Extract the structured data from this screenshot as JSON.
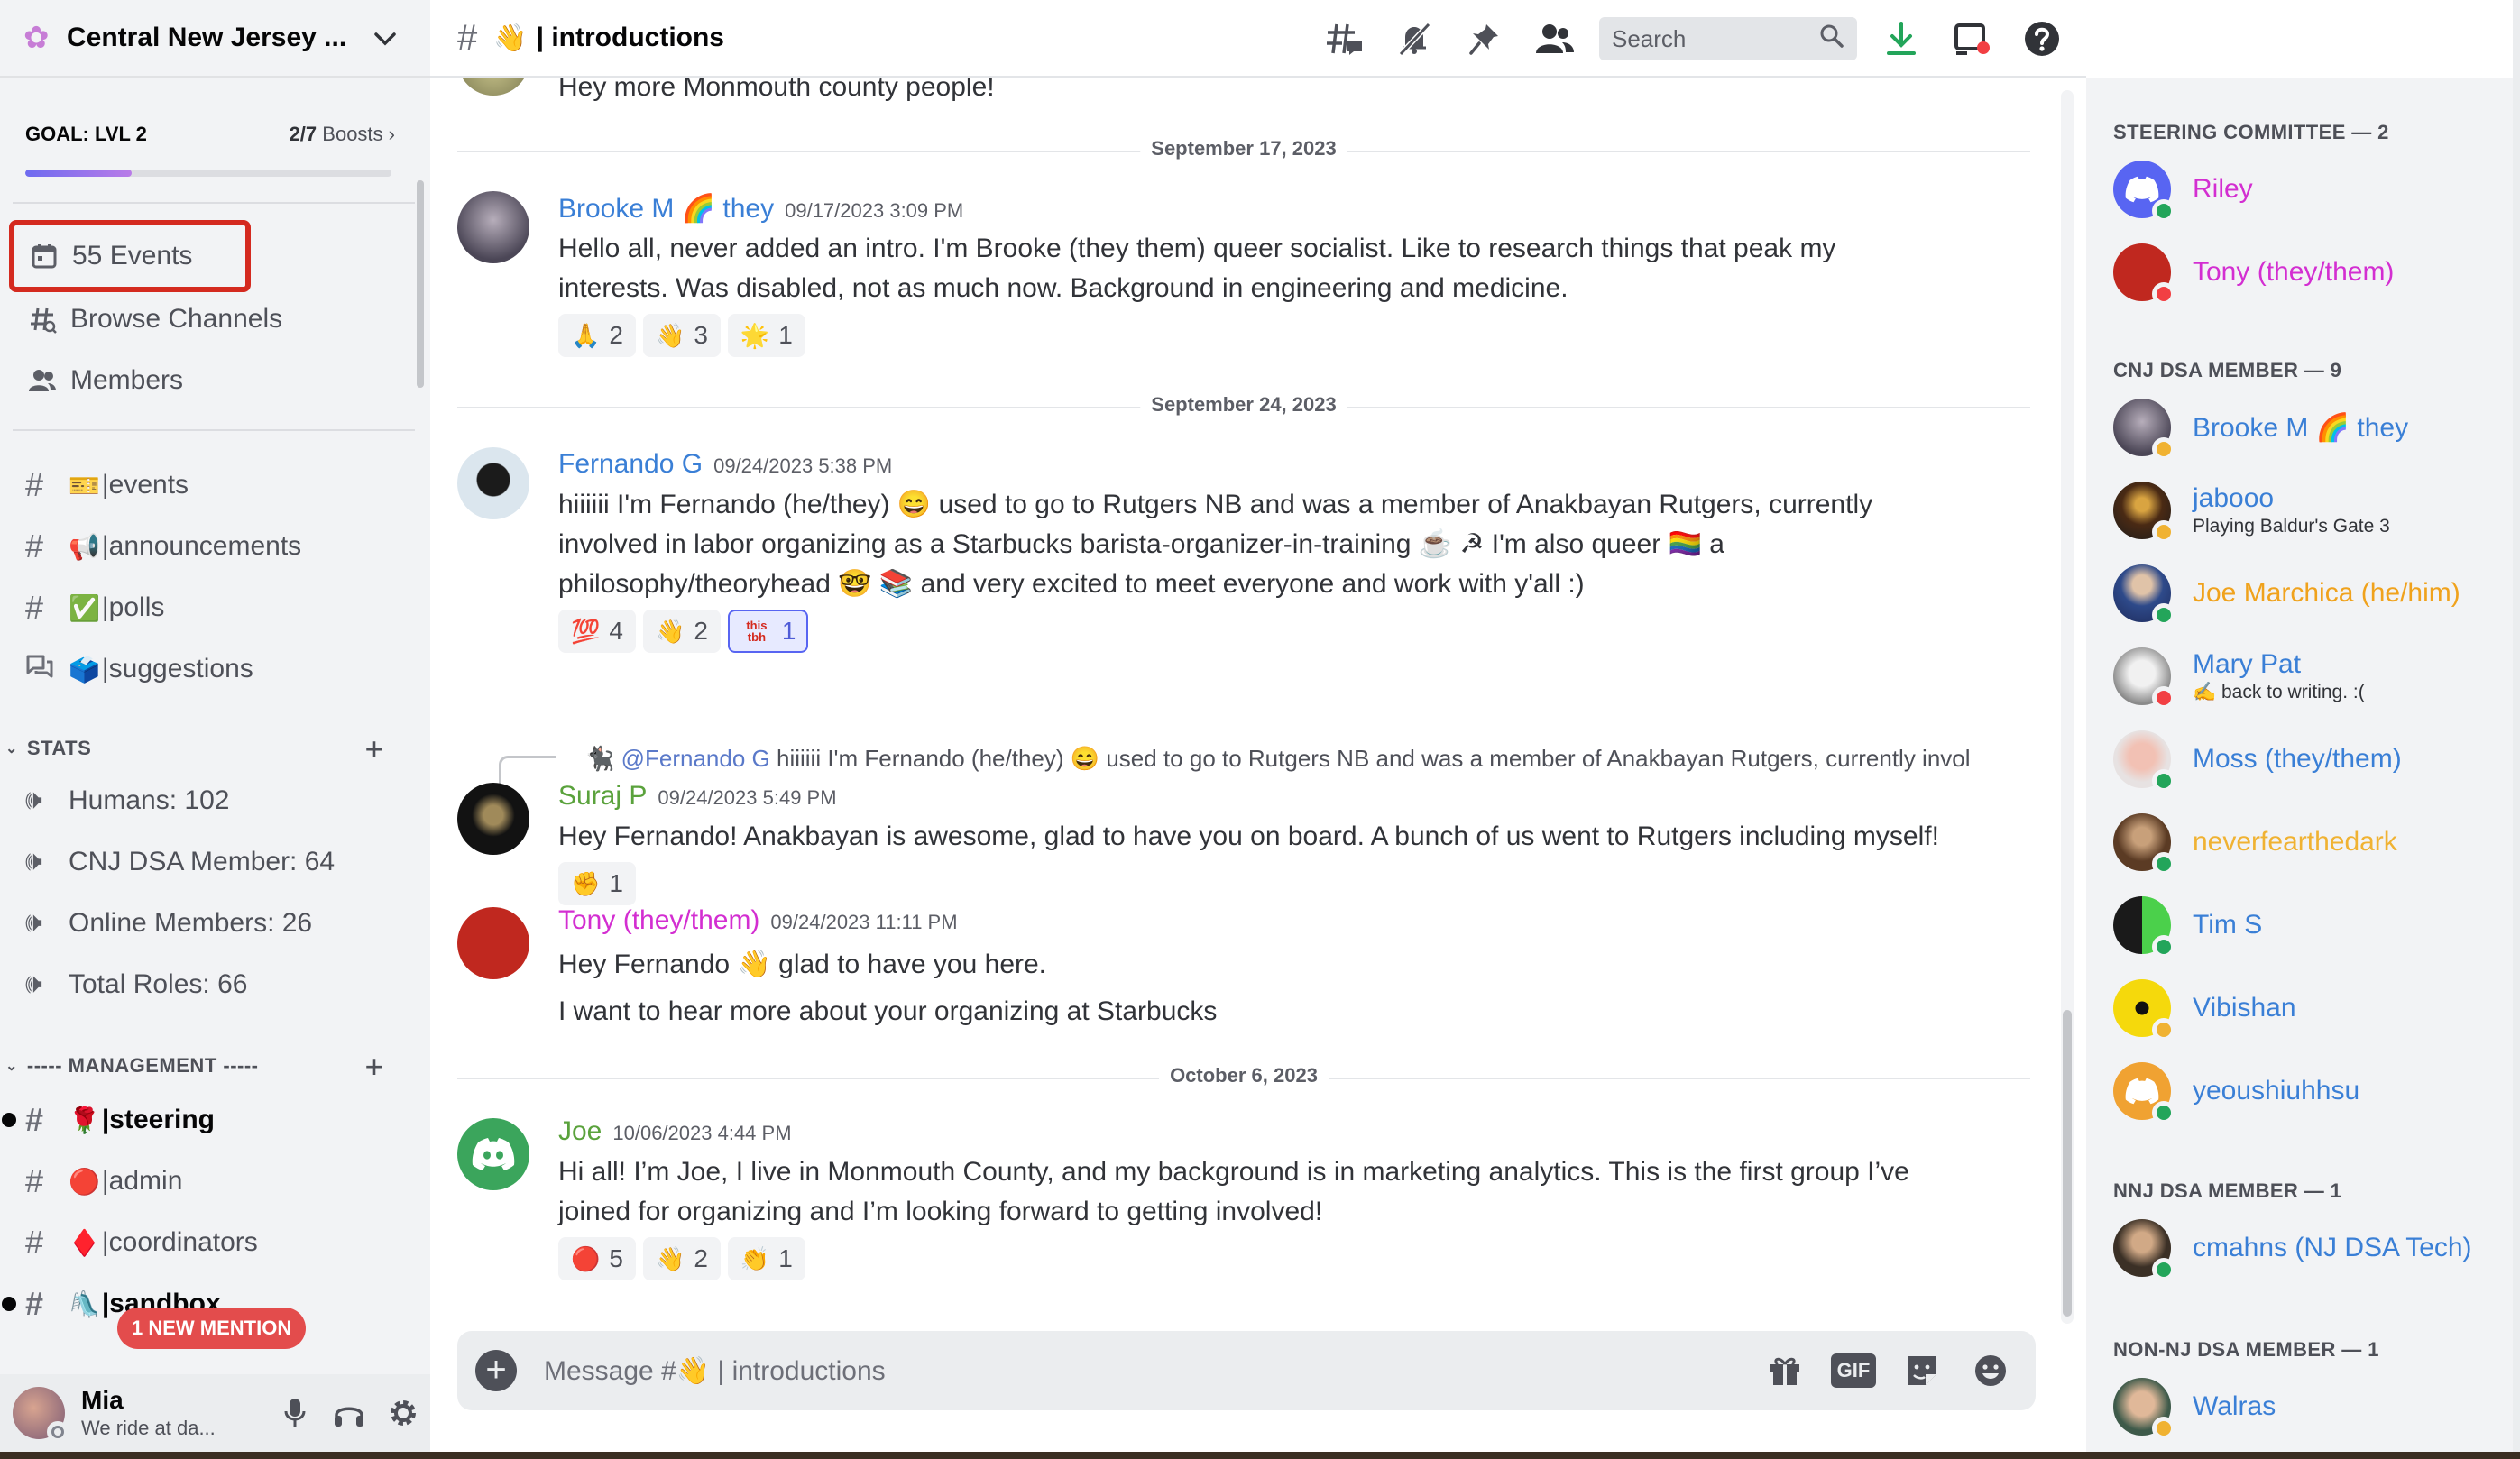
{
  "server": {
    "name": "Central New Jersey ...",
    "icon": "flower-icon"
  },
  "goal": {
    "label": "GOAL: LVL 2",
    "boosts_count": "2/7",
    "boosts_word": "Boosts",
    "progress": 0.29
  },
  "nav": {
    "events": "55 Events",
    "browse": "Browse Channels",
    "members": "Members"
  },
  "channels": [
    {
      "emoji": "🎫",
      "name": "events"
    },
    {
      "emoji": "📢",
      "name": "announcements"
    },
    {
      "emoji": "✅",
      "name": "polls"
    },
    {
      "emoji": "🗳️",
      "name": "suggestions"
    }
  ],
  "stats": {
    "category": "STATS",
    "items": [
      "Humans: 102",
      "CNJ DSA Member: 64",
      "Online Members: 26",
      "Total Roles: 66"
    ]
  },
  "management": {
    "category": "----- MANAGEMENT -----",
    "channels": [
      {
        "emoji": "🌹",
        "name": "steering"
      },
      {
        "emoji": "🔴",
        "name": "admin"
      },
      {
        "emoji": "♦️",
        "name": "coordinators"
      },
      {
        "emoji": "🛝",
        "name": "sandbox"
      }
    ]
  },
  "mention_pill": "1 NEW MENTION",
  "user": {
    "name": "Mia",
    "status": "We ride at da..."
  },
  "header": {
    "channel_emoji": "👋",
    "channel_name": "| introductions",
    "search_placeholder": "Search"
  },
  "top_tail": "Hey more Monmouth county people!",
  "dates": [
    "September 17, 2023",
    "September 24, 2023",
    "October 6, 2023"
  ],
  "messages": [
    {
      "author": "Brooke M 🌈 they",
      "color": "#3a7fd6",
      "time": "09/17/2023 3:09 PM",
      "lines": [
        "Hello all, never added an intro. I'm Brooke (they them) queer socialist. Like to research things that peak my",
        "interests. Was disabled, not as much now. Background in engineering and medicine."
      ],
      "reactions": [
        {
          "e": "🙏",
          "n": "2"
        },
        {
          "e": "👋",
          "n": "3"
        },
        {
          "e": "🌟",
          "n": "1"
        }
      ]
    },
    {
      "author": "Fernando G",
      "color": "#3a7fd6",
      "time": "09/24/2023 5:38 PM",
      "lines": [
        "hiiiiii I'm Fernando (he/they) 😄 used to go to Rutgers NB and was a member of Anakbayan Rutgers, currently",
        "involved in labor organizing as a Starbucks barista-organizer-in-training ☕ ☭ I'm also queer 🏳️‍🌈 a",
        "philosophy/theoryhead 🤓 📚 and very excited to meet everyone and work with y'all :)"
      ],
      "reactions": [
        {
          "e": "💯",
          "n": "4"
        },
        {
          "e": "👋",
          "n": "2"
        },
        {
          "e": "this tbh",
          "n": "1",
          "me": true
        }
      ]
    },
    {
      "author": "Suraj P",
      "color": "#5aa23c",
      "time": "09/24/2023 5:49 PM",
      "reply_mention": "@Fernando G",
      "reply_text": "hiiiiii I'm Fernando (he/they) 😄 used to go to Rutgers NB and was a member of Anakbayan Rutgers, currently invol",
      "lines": [
        "Hey Fernando! Anakbayan is awesome, glad to have you on board. A bunch of us went to Rutgers including myself!"
      ],
      "reactions": [
        {
          "e": "✊",
          "n": "1"
        }
      ]
    },
    {
      "author": "Tony (they/them)",
      "color": "#d32ed1",
      "time": "09/24/2023 11:11 PM",
      "lines": [
        "Hey Fernando 👋 glad to have you here.",
        "I want to hear more about your organizing at Starbucks"
      ],
      "reactions": []
    },
    {
      "author": "Joe",
      "color": "#5aa23c",
      "time": "10/06/2023 4:44 PM",
      "lines": [
        "Hi all! I’m Joe, I live in Monmouth County, and my background is in marketing analytics. This is the first group I’ve",
        "joined for organizing and I’m looking forward to getting involved!"
      ],
      "reactions": [
        {
          "e": "🔴",
          "n": "5"
        },
        {
          "e": "👋",
          "n": "2"
        },
        {
          "e": "👏",
          "n": "1"
        }
      ]
    }
  ],
  "composer": {
    "placeholder": "Message #👋 | introductions",
    "gif": "GIF"
  },
  "member_groups": [
    {
      "title": "STEERING COMMITTEE — 2",
      "members": [
        {
          "name": "Riley",
          "color": "#d32ed1",
          "status": "online",
          "avatar": "discord-blue"
        },
        {
          "name": "Tony (they/them)",
          "color": "#d32ed1",
          "status": "dnd",
          "avatar": "red"
        }
      ]
    },
    {
      "title": "CNJ DSA MEMBER — 9",
      "members": [
        {
          "name": "Brooke M 🌈 they",
          "color": "#3a7fd6",
          "status": "idle",
          "avatar": "grey-photo"
        },
        {
          "name": "jabooo",
          "color": "#3a7fd6",
          "status": "idle",
          "avatar": "dark-photo",
          "sub": "Playing Baldur's Gate 3"
        },
        {
          "name": "Joe Marchica (he/him)",
          "color": "#f0a21c",
          "status": "online",
          "avatar": "blue-photo"
        },
        {
          "name": "Mary Pat",
          "color": "#3a7fd6",
          "status": "dnd",
          "avatar": "goat-photo",
          "sub": "✍️ back to writing. :("
        },
        {
          "name": "Moss (they/them)",
          "color": "#3a7fd6",
          "status": "online",
          "avatar": "pink-photo"
        },
        {
          "name": "neverfearthedark",
          "color": "#f0b232",
          "status": "online",
          "avatar": "brown-photo"
        },
        {
          "name": "Tim S",
          "color": "#3a7fd6",
          "status": "online",
          "avatar": "green-blocks"
        },
        {
          "name": "Vibishan",
          "color": "#3a7fd6",
          "status": "idle",
          "avatar": "radiation"
        },
        {
          "name": "yeoushiuhhsu",
          "color": "#3a7fd6",
          "status": "online",
          "avatar": "discord-orange"
        }
      ]
    },
    {
      "title": "NNJ DSA MEMBER — 1",
      "members": [
        {
          "name": "cmahns (NJ DSA Tech)",
          "color": "#3a7fd6",
          "status": "online",
          "avatar": "man-photo"
        }
      ]
    },
    {
      "title": "NON-NJ DSA MEMBER — 1",
      "members": [
        {
          "name": "Walras",
          "color": "#3a7fd6",
          "status": "idle",
          "avatar": "face-photo"
        }
      ]
    }
  ],
  "colors": {
    "accent": "#5865f2",
    "online": "#23a55a",
    "idle": "#f0b232",
    "dnd": "#f23f43",
    "highlight_box": "#d42a1f"
  }
}
